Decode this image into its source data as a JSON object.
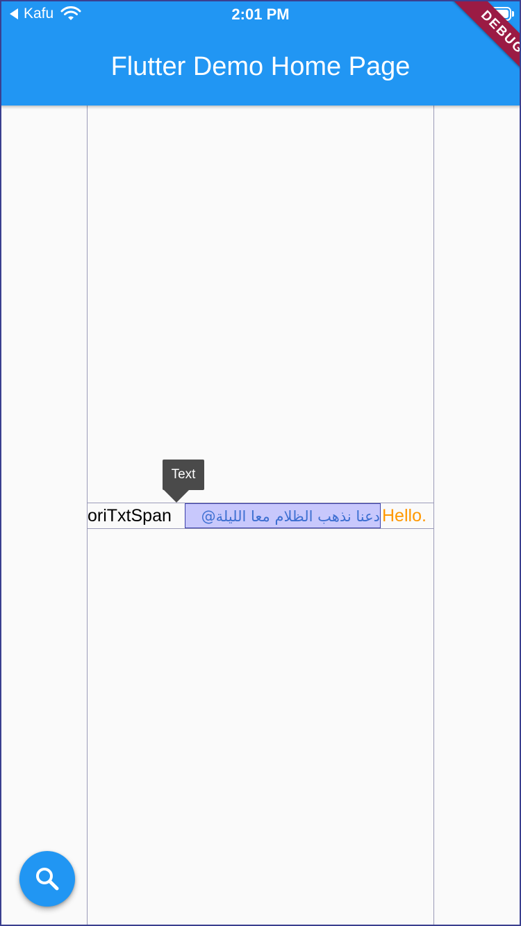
{
  "status_bar": {
    "carrier": "Kafu",
    "time": "2:01 PM"
  },
  "app_bar": {
    "title": "Flutter Demo Home Page",
    "debug_banner": "DEBUG",
    "color": "#2196f3"
  },
  "rich_text": {
    "spans": [
      {
        "text": "oriTxtSpan",
        "color": "#000000"
      },
      {
        "text": "دعنا نذهب الظلام معا الليلة@",
        "color": "#3d6fd1"
      },
      {
        "text": "Hello.",
        "color": "#ff9800"
      }
    ]
  },
  "tooltip": {
    "label": "Text"
  },
  "fab": {
    "icon": "search-icon"
  }
}
